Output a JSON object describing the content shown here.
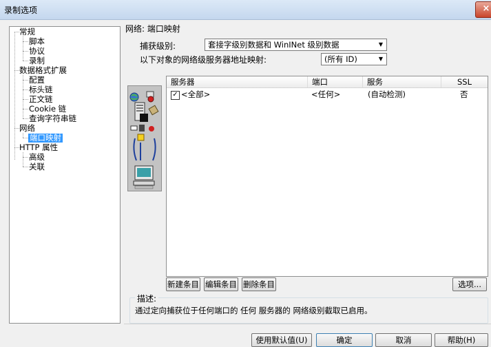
{
  "window": {
    "title": "录制选项",
    "close_label": "×"
  },
  "tree": {
    "items": [
      {
        "label": "常规",
        "level": 0
      },
      {
        "label": "脚本",
        "level": 1
      },
      {
        "label": "协议",
        "level": 1
      },
      {
        "label": "录制",
        "level": 1
      },
      {
        "label": "数据格式扩展",
        "level": 0
      },
      {
        "label": "配置",
        "level": 1
      },
      {
        "label": "标头链",
        "level": 1
      },
      {
        "label": "正文链",
        "level": 1
      },
      {
        "label": "Cookie 链",
        "level": 1
      },
      {
        "label": "查询字符串链",
        "level": 1
      },
      {
        "label": "网络",
        "level": 0
      },
      {
        "label": "端口映射",
        "level": 1,
        "selected": true
      },
      {
        "label": "HTTP 属性",
        "level": 0
      },
      {
        "label": "高级",
        "level": 1
      },
      {
        "label": "关联",
        "level": 1
      }
    ]
  },
  "section": {
    "title": "网络: 端口映射"
  },
  "capture_level": {
    "label": "捕获级别:",
    "value": "套接字级别数据和 WinINet 级别数据"
  },
  "mapping_target": {
    "label": "以下对象的网络级服务器地址映射:",
    "value": "(所有 ID)"
  },
  "table": {
    "columns": [
      "服务器",
      "端口",
      "服务",
      "SSL"
    ],
    "rows": [
      {
        "checked": true,
        "server": "<全部>",
        "port": "<任何>",
        "service": "(自动检测)",
        "ssl": "否"
      }
    ]
  },
  "entry_buttons": {
    "new": "新建条目",
    "edit": "编辑条目",
    "delete": "删除条目",
    "options": "选项..."
  },
  "description": {
    "title": "描述:",
    "text": "通过定向捕获位于任何端口的 任何 服务器的  网络级别截取已启用。"
  },
  "footer_buttons": {
    "defaults": "使用默认值(U)",
    "ok": "确定",
    "cancel": "取消",
    "help": "帮助(H)"
  },
  "colors": {
    "selection": "#3399ff",
    "titlebar": "#dce9f7"
  },
  "icons": [
    "globe-icon",
    "network-devices-icon",
    "server-tower-icon",
    "database-icon",
    "computer-monitor-icon"
  ]
}
